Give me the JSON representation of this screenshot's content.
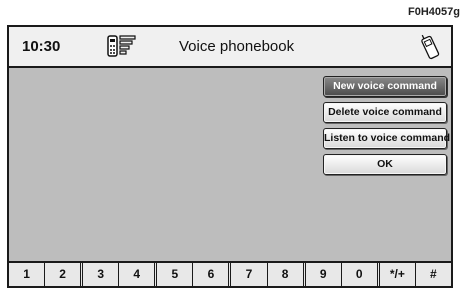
{
  "figure_code": "F0H4057g",
  "header": {
    "time": "10:30",
    "title": "Voice phonebook",
    "left_icon": "phone-signal-icon",
    "right_icon": "mobile-phone-icon"
  },
  "menu": {
    "items": [
      {
        "label": "New voice command",
        "selected": true
      },
      {
        "label": "Delete voice command",
        "selected": false
      },
      {
        "label": "Listen to voice command",
        "selected": false
      },
      {
        "label": "OK",
        "selected": false
      }
    ]
  },
  "keypad": {
    "keys": [
      "1",
      "2",
      "3",
      "4",
      "5",
      "6",
      "7",
      "8",
      "9",
      "0",
      "*/+",
      "#"
    ]
  },
  "colors": {
    "screen_background": "#bdbdbd",
    "selected_button": "#6a6a6a"
  }
}
